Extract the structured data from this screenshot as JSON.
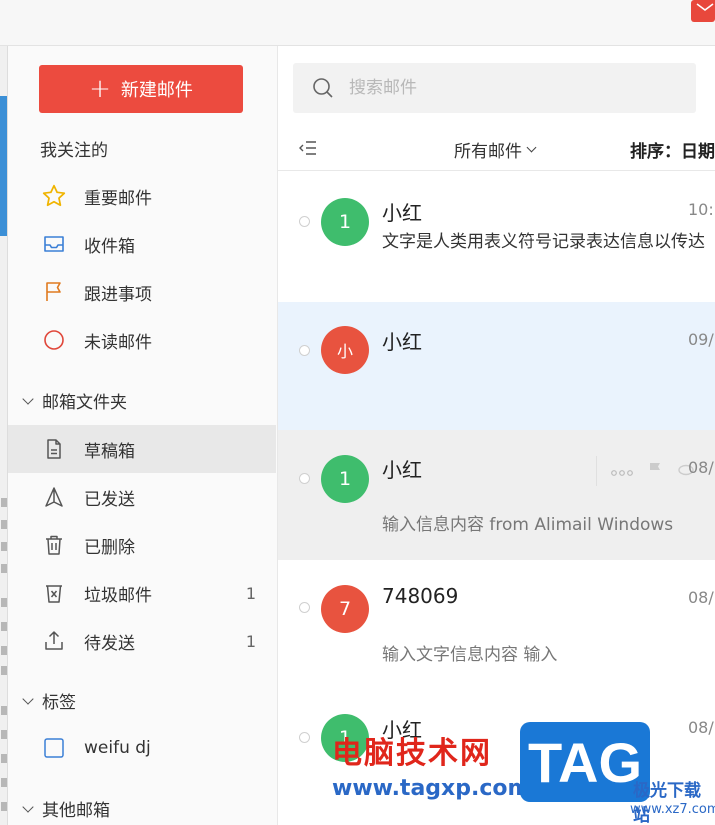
{
  "sidebar": {
    "new_mail_label": "新建邮件",
    "favorites_title": "我关注的",
    "favorites": [
      {
        "label": "重要邮件",
        "icon": "star-icon",
        "color": "#f0b400"
      },
      {
        "label": "收件箱",
        "icon": "inbox-icon",
        "color": "#3b7fd6"
      },
      {
        "label": "跟进事项",
        "icon": "flag-icon",
        "color": "#e07a1f"
      },
      {
        "label": "未读邮件",
        "icon": "unread-circle-icon",
        "color": "#e0473a"
      }
    ],
    "folders_title": "邮箱文件夹",
    "folders": [
      {
        "label": "草稿箱",
        "icon": "draft-icon",
        "count": ""
      },
      {
        "label": "已发送",
        "icon": "sent-icon",
        "count": ""
      },
      {
        "label": "已删除",
        "icon": "trash-icon",
        "count": ""
      },
      {
        "label": "垃圾邮件",
        "icon": "spam-icon",
        "count": "1"
      },
      {
        "label": "待发送",
        "icon": "outbox-icon",
        "count": "1"
      }
    ],
    "tags_title": "标签",
    "tags": [
      {
        "label": "weifu dj",
        "icon": "tag-checkbox-icon"
      }
    ],
    "other_title": "其他邮箱"
  },
  "main": {
    "search_placeholder": "搜索邮件",
    "filter_label": "所有邮件",
    "sort_label": "排序：日期",
    "mails": [
      {
        "avatar": "1",
        "avatar_color": "#3fbd6d",
        "sender": "小红",
        "time": "10:",
        "subject": "文字是人类用表义符号记录表达信息以传达",
        "preview": ""
      },
      {
        "avatar": "小",
        "avatar_color": "#e8533f",
        "sender": "小红",
        "time": "09/",
        "subject": "",
        "preview": ""
      },
      {
        "avatar": "1",
        "avatar_color": "#3fbd6d",
        "sender": "小红",
        "time": "08/",
        "subject": "",
        "preview": "输入信息内容 from Alimail Windows"
      },
      {
        "avatar": "7",
        "avatar_color": "#e8533f",
        "sender": "748069",
        "time": "08/",
        "subject": "",
        "preview": "输入文字信息内容 输入"
      },
      {
        "avatar": "1",
        "avatar_color": "#3fbd6d",
        "sender": "小红",
        "time": "08/",
        "subject": "",
        "preview": ""
      }
    ]
  },
  "watermark": {
    "title": "电脑技术网",
    "url": "www.tagxp.com",
    "badge": "TAG",
    "side_text": "极光下载站",
    "side_url": "www.xz7.com"
  },
  "colors": {
    "accent": "#ec4b3f",
    "selected_row": "#eaf3fd",
    "active_nav": "#e8e8e8"
  }
}
